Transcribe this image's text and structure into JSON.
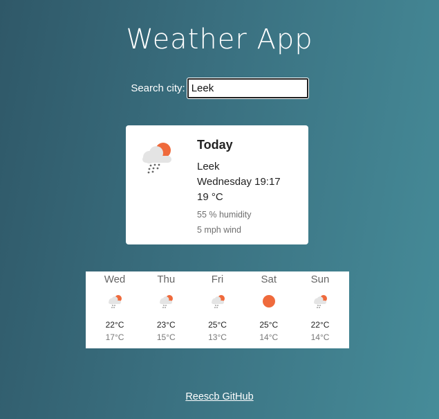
{
  "app": {
    "title": "Weather App"
  },
  "search": {
    "label": "Search city:",
    "value": "Leek"
  },
  "today": {
    "heading": "Today",
    "icon": "sun-cloud-rain-icon",
    "city": "Leek",
    "datetime": "Wednesday 19:17",
    "temperature": "19 °C",
    "humidity": "55 % humidity",
    "wind": "5 mph wind"
  },
  "forecast": [
    {
      "day": "Wed",
      "icon": "sun-cloud-rain-icon",
      "high": "22°C",
      "low": "17°C"
    },
    {
      "day": "Thu",
      "icon": "sun-cloud-rain-icon",
      "high": "23°C",
      "low": "15°C"
    },
    {
      "day": "Fri",
      "icon": "sun-cloud-rain-icon",
      "high": "25°C",
      "low": "13°C"
    },
    {
      "day": "Sat",
      "icon": "sun-icon",
      "high": "25°C",
      "low": "14°C"
    },
    {
      "day": "Sun",
      "icon": "sun-cloud-rain-icon",
      "high": "22°C",
      "low": "14°C"
    }
  ],
  "footer": {
    "link_label": "Reescb GitHub"
  },
  "colors": {
    "sun": "#ef6a3c",
    "cloud": "#e4e4e4",
    "rain": "#666666"
  }
}
